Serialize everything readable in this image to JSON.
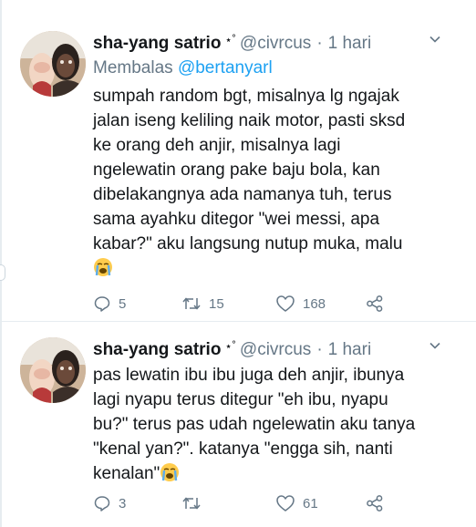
{
  "tweets": [
    {
      "name": "sha-yang satrio",
      "badge": "⋆˚",
      "handle": "@civrcus",
      "separator": "·",
      "time": "1 hari",
      "replying_prefix": "Membalas",
      "replying_to": "@bertanyarl",
      "text_lines": [
        "sumpah random bgt, misalnya lg ngajak",
        "jalan iseng keliling naik motor, pasti sksd",
        "ke orang deh anjir, misalnya lagi",
        "ngelewatin orang pake baju bola, kan",
        "dibelakangnya ada namanya tuh, terus",
        "sama ayahku ditegor \"wei messi, apa",
        "kabar?\" aku langsung nutup muka, malu"
      ],
      "emoji": "loudly-crying-face",
      "replies": "5",
      "retweets": "15",
      "likes": "168"
    },
    {
      "name": "sha-yang satrio",
      "badge": "⋆˚",
      "handle": "@civrcus",
      "separator": "·",
      "time": "1 hari",
      "text_lines": [
        "pas lewatin ibu ibu juga deh anjir, ibunya",
        "lagi nyapu terus ditegur \"eh ibu, nyapu",
        "bu?\" terus pas udah ngelewatin aku tanya",
        "\"kenal yan?\". katanya \"engga sih, nanti",
        "kenalan\""
      ],
      "emoji": "loudly-crying-face",
      "replies": "3",
      "retweets": "",
      "likes": "61"
    }
  ],
  "colors": {
    "text": "#14171a",
    "muted": "#657786",
    "accent": "#1da1f2",
    "divider": "#e6ecf0"
  },
  "icons": [
    "chevron-down-icon",
    "reply-icon",
    "retweet-icon",
    "like-icon",
    "share-icon",
    "loudly-crying-face-emoji"
  ]
}
